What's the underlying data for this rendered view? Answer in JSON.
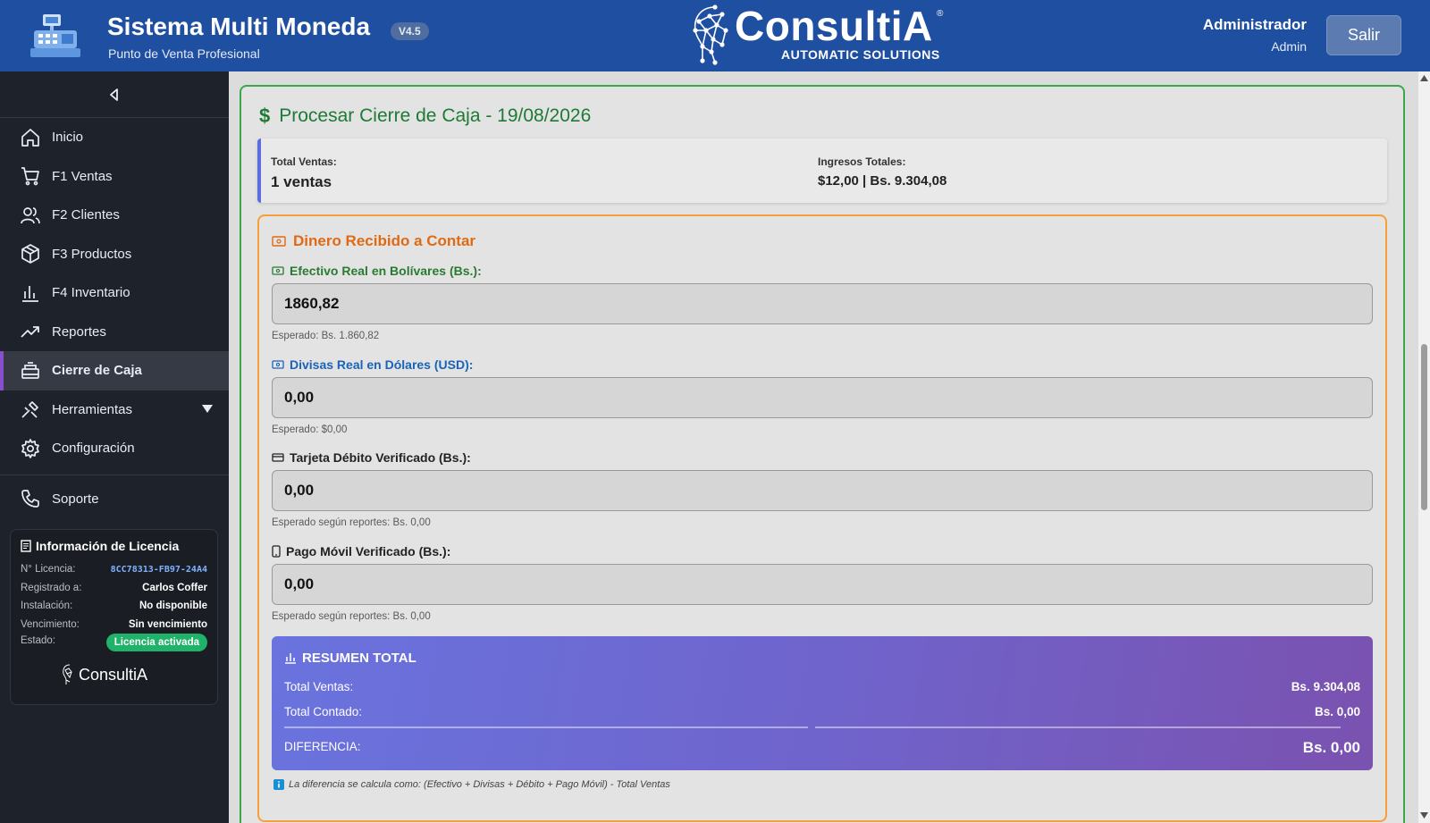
{
  "header": {
    "app_title": "Sistema Multi Moneda",
    "version": "V4.5",
    "subtitle": "Punto de Venta Profesional",
    "logo_word": "ConsultiA",
    "logo_tagline": "AUTOMATIC SOLUTIONS",
    "logo_reg": "®",
    "user_name": "Administrador",
    "user_role": "Admin",
    "logout_label": "Salir"
  },
  "sidebar": {
    "items": [
      {
        "label": "Inicio",
        "icon": "home-icon"
      },
      {
        "label": "F1 Ventas",
        "icon": "cart-icon"
      },
      {
        "label": "F2 Clientes",
        "icon": "users-icon"
      },
      {
        "label": "F3 Productos",
        "icon": "box-icon"
      },
      {
        "label": "F4 Inventario",
        "icon": "bar-chart-icon"
      },
      {
        "label": "Reportes",
        "icon": "trend-icon"
      },
      {
        "label": "Cierre de Caja",
        "icon": "cash-register-icon",
        "active": true
      },
      {
        "label": "Herramientas",
        "icon": "tools-icon"
      },
      {
        "label": "Configuración",
        "icon": "gear-icon"
      },
      {
        "label": "Soporte",
        "icon": "phone-icon"
      }
    ],
    "license": {
      "title": "Información de Licencia",
      "number_label": "N° Licencia:",
      "number_value": "8CC78313-FB97-24A4",
      "registered_label": "Registrado a:",
      "registered_value": "Carlos Coffer",
      "install_label": "Instalación:",
      "install_value": "No disponible",
      "expiry_label": "Vencimiento:",
      "expiry_value": "Sin vencimiento",
      "status_label": "Estado:",
      "status_value": "Licencia activada",
      "logo": "ConsultiA"
    }
  },
  "main": {
    "title": "Procesar Cierre de Caja - 19/08/2026",
    "summary": {
      "sales_label": "Total Ventas:",
      "sales_value": "1 ventas",
      "income_label": "Ingresos Totales:",
      "income_value": "$12,00 | Bs. 9.304,08"
    },
    "count": {
      "title": "Dinero Recibido a Contar",
      "fields": [
        {
          "label": "Efectivo Real en Bolívares (Bs.):",
          "value": "1860,82",
          "hint": "Esperado: Bs. 1.860,82"
        },
        {
          "label": "Divisas Real en Dólares (USD):",
          "value": "0,00",
          "hint": "Esperado: $0,00"
        },
        {
          "label": "Tarjeta Débito Verificado (Bs.):",
          "value": "0,00",
          "hint": "Esperado según reportes: Bs. 0,00"
        },
        {
          "label": "Pago Móvil Verificado (Bs.):",
          "value": "0,00",
          "hint": "Esperado según reportes: Bs. 0,00"
        }
      ]
    },
    "total": {
      "title": "RESUMEN TOTAL",
      "sales_label": "Total Ventas:",
      "sales_value": "Bs. 9.304,08",
      "counted_label": "Total Contado:",
      "counted_value": "Bs. 0,00",
      "diff_label": "DIFERENCIA:",
      "diff_value": "Bs. 0,00"
    },
    "note": "La diferencia se calcula como: (Efectivo + Divisas + Débito + Pago Móvil) - Total Ventas"
  },
  "colors": {
    "header_bg": "#1f4fa0",
    "sidebar_bg": "#1e222b",
    "active_accent": "#8a4fcf",
    "panel_border": "#3aa84a",
    "count_border": "#f5a03a",
    "badge_green": "#20b26b"
  }
}
